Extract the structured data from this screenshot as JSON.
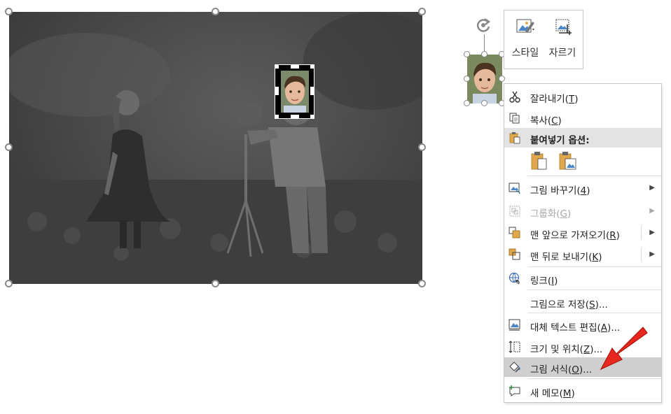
{
  "minitoolbar": {
    "style_label": "스타일",
    "crop_label": "자르기"
  },
  "menu": {
    "items": [
      {
        "label": "잘라내기(",
        "key": "T",
        "suffix": ")"
      },
      {
        "label": "복사(",
        "key": "C",
        "suffix": ")"
      },
      {
        "header": "붙여넣기 옵션:"
      },
      {
        "label": "그림 바꾸기(",
        "key": "4",
        "suffix": ")"
      },
      {
        "label": "그룹화(",
        "key": "G",
        "suffix": ")"
      },
      {
        "label": "맨 앞으로 가져오기(",
        "key": "R",
        "suffix": ")"
      },
      {
        "label": "맨 뒤로 보내기(",
        "key": "K",
        "suffix": ")"
      },
      {
        "label": "링크(",
        "key": "I",
        "suffix": ")"
      },
      {
        "label": "그림으로 저장(",
        "key": "S",
        "suffix": ")..."
      },
      {
        "label": "대체 텍스트 편집(",
        "key": "A",
        "suffix": ")..."
      },
      {
        "label": "크기 및 위치(",
        "key": "Z",
        "suffix": ")..."
      },
      {
        "label": "그림 서식(",
        "key": "O",
        "suffix": ")..."
      },
      {
        "label": "새 메모(",
        "key": "M",
        "suffix": ")"
      }
    ]
  },
  "colors": {
    "accent_red": "#e8281e",
    "highlight": "#cfcfcf",
    "paste_icon": "#e0a84a"
  }
}
